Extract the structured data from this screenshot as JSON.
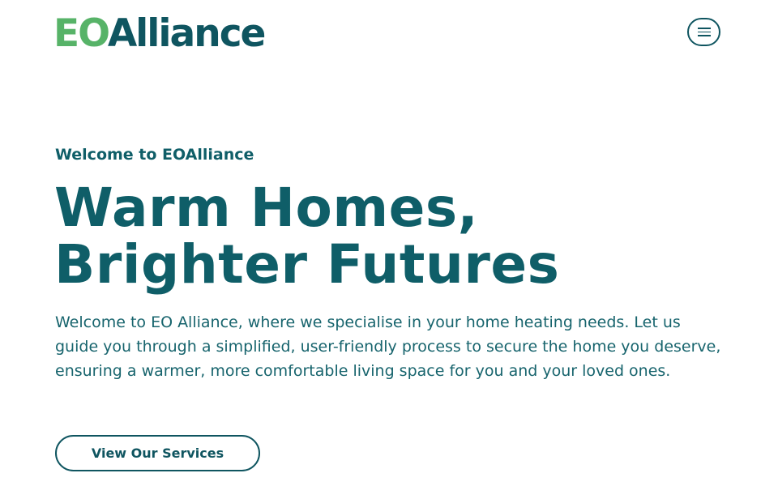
{
  "header": {
    "logo": {
      "part_1": "EO",
      "part_2": "Alliance"
    },
    "menu_button_icon": "hamburger-menu-icon"
  },
  "hero": {
    "eyebrow": "Welcome to EOAlliance",
    "headline_line_1": "Warm Homes,",
    "headline_line_2": "Brighter Futures",
    "intro": "Welcome to EO Alliance, where we specialise in your home heating needs. Let us guide you through a simplified, user-friendly process to secure the home you deserve, ensuring a warmer, more comfortable living space for you and your loved ones.",
    "cta_label": "View Our Services"
  },
  "colors": {
    "brand_green": "#57b368",
    "brand_teal": "#0f5560",
    "text_teal": "#17646d",
    "background": "#ffffff"
  }
}
